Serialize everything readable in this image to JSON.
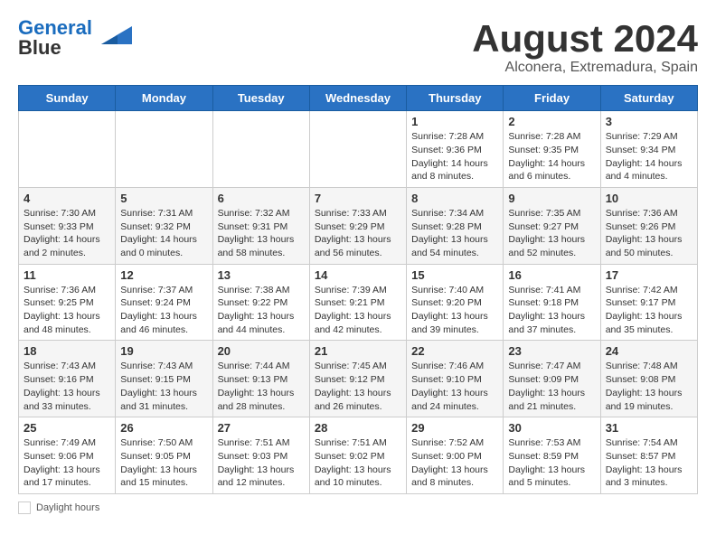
{
  "header": {
    "logo_line1": "General",
    "logo_line2": "Blue",
    "main_title": "August 2024",
    "sub_title": "Alconera, Extremadura, Spain"
  },
  "days_of_week": [
    "Sunday",
    "Monday",
    "Tuesday",
    "Wednesday",
    "Thursday",
    "Friday",
    "Saturday"
  ],
  "weeks": [
    [
      {
        "day": "",
        "info": ""
      },
      {
        "day": "",
        "info": ""
      },
      {
        "day": "",
        "info": ""
      },
      {
        "day": "",
        "info": ""
      },
      {
        "day": "1",
        "info": "Sunrise: 7:28 AM\nSunset: 9:36 PM\nDaylight: 14 hours and 8 minutes."
      },
      {
        "day": "2",
        "info": "Sunrise: 7:28 AM\nSunset: 9:35 PM\nDaylight: 14 hours and 6 minutes."
      },
      {
        "day": "3",
        "info": "Sunrise: 7:29 AM\nSunset: 9:34 PM\nDaylight: 14 hours and 4 minutes."
      }
    ],
    [
      {
        "day": "4",
        "info": "Sunrise: 7:30 AM\nSunset: 9:33 PM\nDaylight: 14 hours and 2 minutes."
      },
      {
        "day": "5",
        "info": "Sunrise: 7:31 AM\nSunset: 9:32 PM\nDaylight: 14 hours and 0 minutes."
      },
      {
        "day": "6",
        "info": "Sunrise: 7:32 AM\nSunset: 9:31 PM\nDaylight: 13 hours and 58 minutes."
      },
      {
        "day": "7",
        "info": "Sunrise: 7:33 AM\nSunset: 9:29 PM\nDaylight: 13 hours and 56 minutes."
      },
      {
        "day": "8",
        "info": "Sunrise: 7:34 AM\nSunset: 9:28 PM\nDaylight: 13 hours and 54 minutes."
      },
      {
        "day": "9",
        "info": "Sunrise: 7:35 AM\nSunset: 9:27 PM\nDaylight: 13 hours and 52 minutes."
      },
      {
        "day": "10",
        "info": "Sunrise: 7:36 AM\nSunset: 9:26 PM\nDaylight: 13 hours and 50 minutes."
      }
    ],
    [
      {
        "day": "11",
        "info": "Sunrise: 7:36 AM\nSunset: 9:25 PM\nDaylight: 13 hours and 48 minutes."
      },
      {
        "day": "12",
        "info": "Sunrise: 7:37 AM\nSunset: 9:24 PM\nDaylight: 13 hours and 46 minutes."
      },
      {
        "day": "13",
        "info": "Sunrise: 7:38 AM\nSunset: 9:22 PM\nDaylight: 13 hours and 44 minutes."
      },
      {
        "day": "14",
        "info": "Sunrise: 7:39 AM\nSunset: 9:21 PM\nDaylight: 13 hours and 42 minutes."
      },
      {
        "day": "15",
        "info": "Sunrise: 7:40 AM\nSunset: 9:20 PM\nDaylight: 13 hours and 39 minutes."
      },
      {
        "day": "16",
        "info": "Sunrise: 7:41 AM\nSunset: 9:18 PM\nDaylight: 13 hours and 37 minutes."
      },
      {
        "day": "17",
        "info": "Sunrise: 7:42 AM\nSunset: 9:17 PM\nDaylight: 13 hours and 35 minutes."
      }
    ],
    [
      {
        "day": "18",
        "info": "Sunrise: 7:43 AM\nSunset: 9:16 PM\nDaylight: 13 hours and 33 minutes."
      },
      {
        "day": "19",
        "info": "Sunrise: 7:43 AM\nSunset: 9:15 PM\nDaylight: 13 hours and 31 minutes."
      },
      {
        "day": "20",
        "info": "Sunrise: 7:44 AM\nSunset: 9:13 PM\nDaylight: 13 hours and 28 minutes."
      },
      {
        "day": "21",
        "info": "Sunrise: 7:45 AM\nSunset: 9:12 PM\nDaylight: 13 hours and 26 minutes."
      },
      {
        "day": "22",
        "info": "Sunrise: 7:46 AM\nSunset: 9:10 PM\nDaylight: 13 hours and 24 minutes."
      },
      {
        "day": "23",
        "info": "Sunrise: 7:47 AM\nSunset: 9:09 PM\nDaylight: 13 hours and 21 minutes."
      },
      {
        "day": "24",
        "info": "Sunrise: 7:48 AM\nSunset: 9:08 PM\nDaylight: 13 hours and 19 minutes."
      }
    ],
    [
      {
        "day": "25",
        "info": "Sunrise: 7:49 AM\nSunset: 9:06 PM\nDaylight: 13 hours and 17 minutes."
      },
      {
        "day": "26",
        "info": "Sunrise: 7:50 AM\nSunset: 9:05 PM\nDaylight: 13 hours and 15 minutes."
      },
      {
        "day": "27",
        "info": "Sunrise: 7:51 AM\nSunset: 9:03 PM\nDaylight: 13 hours and 12 minutes."
      },
      {
        "day": "28",
        "info": "Sunrise: 7:51 AM\nSunset: 9:02 PM\nDaylight: 13 hours and 10 minutes."
      },
      {
        "day": "29",
        "info": "Sunrise: 7:52 AM\nSunset: 9:00 PM\nDaylight: 13 hours and 8 minutes."
      },
      {
        "day": "30",
        "info": "Sunrise: 7:53 AM\nSunset: 8:59 PM\nDaylight: 13 hours and 5 minutes."
      },
      {
        "day": "31",
        "info": "Sunrise: 7:54 AM\nSunset: 8:57 PM\nDaylight: 13 hours and 3 minutes."
      }
    ]
  ],
  "footer": {
    "label": "Daylight hours"
  }
}
